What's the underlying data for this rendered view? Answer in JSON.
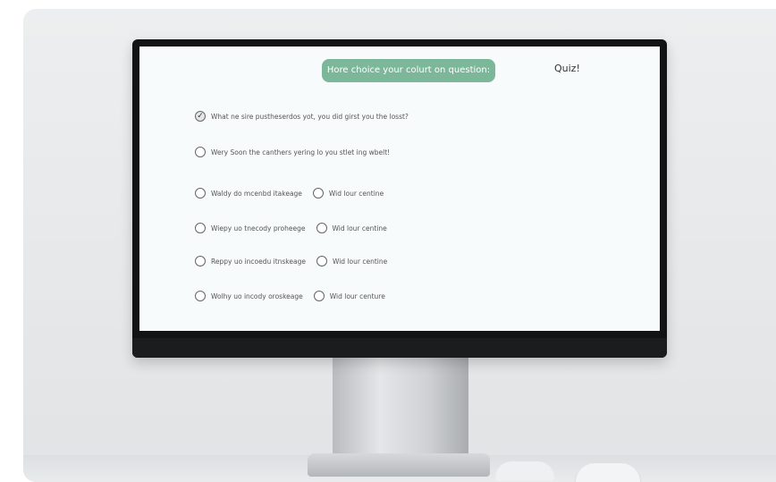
{
  "screen": {
    "header": "Hore choice your colurt on question:",
    "quiz_label": "Quiz!"
  },
  "questions": [
    {
      "text": "What ne sire pustheserdos yot, you did girst you the losst?",
      "checked": true
    },
    {
      "text": "Wery Soon the canthers yering lo you stlet ing wbelt!",
      "checked": false
    }
  ],
  "option_rows": [
    {
      "a": "Waldy do mcenbd itakeage",
      "b": "Wid lour centine"
    },
    {
      "a": "Wiepy uo tnecody proheege",
      "b": "Wid lour centine"
    },
    {
      "a": "Reppy uo incoedu itnskeage",
      "b": "Wid lour centine"
    },
    {
      "a": "Wolhy uo incody oroskeage",
      "b": "Wid lour centure"
    }
  ],
  "colors": {
    "header_pill": "#7cb79a",
    "screen": "#f8fbfb",
    "bezel": "#111315"
  },
  "icons": {
    "checkmark": "check-icon",
    "radio": "radio-circle-icon"
  }
}
